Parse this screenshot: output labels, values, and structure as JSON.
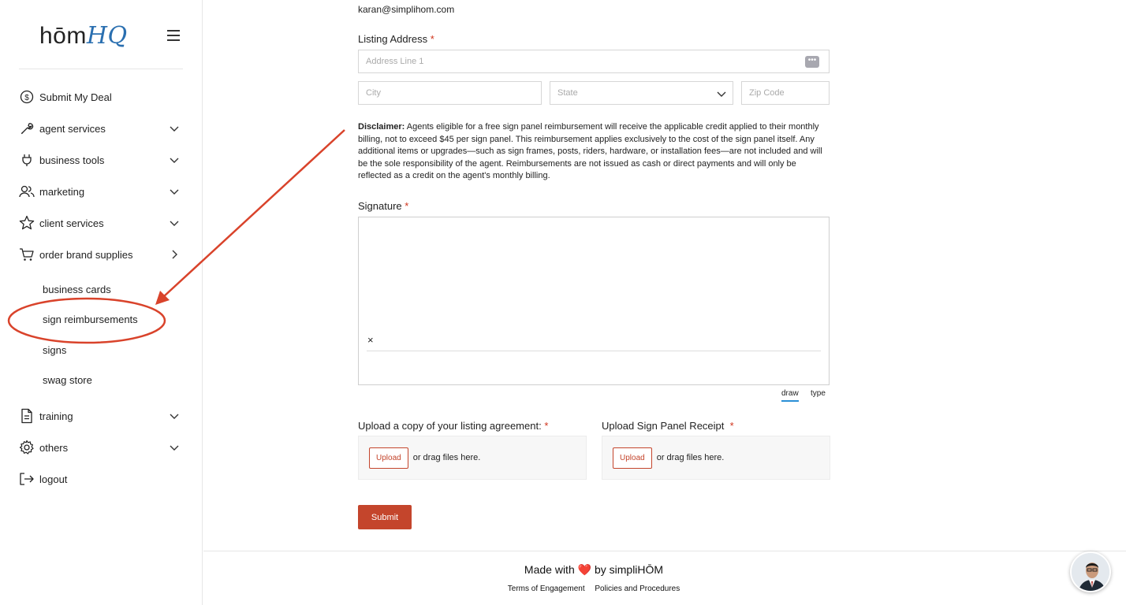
{
  "sidebar": {
    "logo_text": "hōm",
    "logo_accent": "HQ",
    "items": [
      {
        "label": "Submit My Deal",
        "icon": "dollar-circle-icon"
      },
      {
        "label": "agent services",
        "icon": "wrench-icon"
      },
      {
        "label": "business tools",
        "icon": "plug-icon"
      },
      {
        "label": "marketing",
        "icon": "users-icon"
      },
      {
        "label": "client services",
        "icon": "star-icon"
      },
      {
        "label": "order brand supplies",
        "icon": "cart-icon"
      },
      {
        "label": "training",
        "icon": "document-icon"
      },
      {
        "label": "others",
        "icon": "gear-icon"
      },
      {
        "label": "logout",
        "icon": "logout-icon"
      }
    ],
    "sub_items": [
      "business cards",
      "sign reimbursements",
      "signs",
      "swag store"
    ]
  },
  "form": {
    "email": "karan@simplihom.com",
    "listing_address_label": "Listing Address",
    "required_mark": "*",
    "address_placeholder": "Address Line 1",
    "city_placeholder": "City",
    "state_placeholder": "State",
    "zip_placeholder": "Zip Code",
    "disclaimer_title": "Disclaimer:",
    "disclaimer_text": "Agents eligible for a free sign panel reimbursement will receive the applicable credit applied to their monthly billing, not to exceed $45 per sign panel. This reimbursement applies exclusively to the cost of the sign panel itself. Any additional items or upgrades—such as sign frames, posts, riders, hardware, or installation fees—are not included and will be the sole responsibility of the agent. Reimbursements are not issued as cash or direct payments and will only be reflected as a credit on the agent's monthly billing.",
    "signature_label": "Signature",
    "signature_x": "×",
    "sig_tab_draw": "draw",
    "sig_tab_type": "type",
    "upload1_label": "Upload a copy of your listing agreement:",
    "upload2_label": "Upload Sign Panel Receipt",
    "upload_button": "Upload",
    "upload_hint": "or drag files here.",
    "submit_label": "Submit"
  },
  "footer": {
    "made_prefix": "Made with",
    "heart": "❤️",
    "made_suffix": "by simpliHŌM",
    "link_terms": "Terms of Engagement",
    "link_policies": "Policies and Procedures"
  },
  "colors": {
    "accent": "#c4452c",
    "annotation": "#d9432b",
    "logo_hq": "#2a6fb0",
    "tab_underline": "#2a8fd6"
  }
}
